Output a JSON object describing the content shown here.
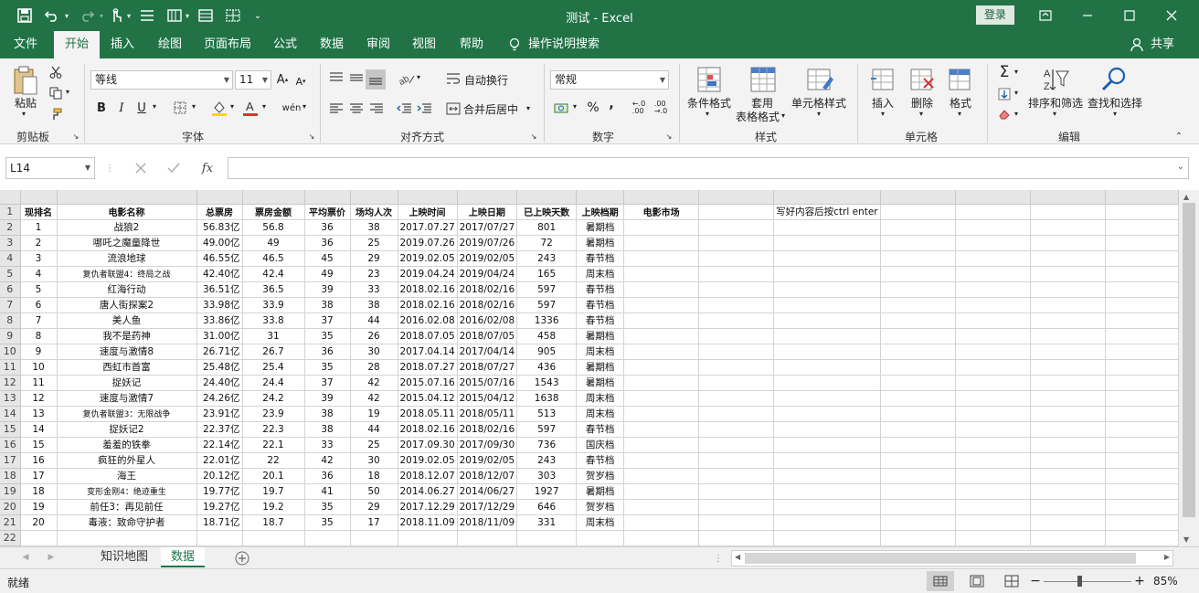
{
  "titlebar": {
    "doc_title": "测试  -  Excel",
    "login": "登录",
    "icons": [
      "save-icon",
      "undo-icon",
      "redo-icon",
      "touch-mode-icon",
      "list-icon",
      "form-icon",
      "borders-icon",
      "table-icon",
      "customize-qat-icon"
    ]
  },
  "tabs": [
    "文件",
    "开始",
    "插入",
    "绘图",
    "页面布局",
    "公式",
    "数据",
    "审阅",
    "视图",
    "帮助"
  ],
  "tell_me": "操作说明搜索",
  "share": "共享",
  "ribbon": {
    "clipboard": {
      "paste": "粘贴",
      "label": "剪贴板"
    },
    "font": {
      "name": "等线",
      "size": "11",
      "label": "字体",
      "bold": "B",
      "italic": "I",
      "underline": "U"
    },
    "alignment": {
      "wrap": "自动换行",
      "merge": "合并后居中",
      "label": "对齐方式"
    },
    "number": {
      "format": "常规",
      "percent": "%",
      "comma": ",",
      "label": "数字"
    },
    "styles": {
      "cond": "条件格式",
      "table1": "套用",
      "table2": "表格格式",
      "cell": "单元格样式",
      "label": "样式"
    },
    "cells": {
      "insert": "插入",
      "delete": "删除",
      "format": "格式",
      "label": "单元格"
    },
    "editing": {
      "sort": "排序和筛选",
      "find": "查找和选择",
      "label": "编辑"
    }
  },
  "formula_bar": {
    "name_box": "L14",
    "fx": "fx",
    "value": ""
  },
  "columns": [
    "A",
    "B",
    "C",
    "D",
    "E",
    "F",
    "G",
    "H",
    "I",
    "J",
    "K",
    "L",
    "M",
    "N",
    "O",
    "P",
    "Q"
  ],
  "headers": [
    "现排名",
    "电影名称",
    "总票房",
    "票房金额",
    "平均票价",
    "场均人次",
    "上映时间",
    "上映日期",
    "已上映天数",
    "上映档期",
    "电影市场",
    "",
    "写好内容后按ctrl enter",
    "",
    "",
    "",
    ""
  ],
  "rows": [
    [
      "1",
      "战狼2",
      "56.83亿",
      "56.8",
      "36",
      "38",
      "2017.07.27",
      "2017/07/27",
      "801",
      "暑期档"
    ],
    [
      "2",
      "哪吒之魔童降世",
      "49.00亿",
      "49",
      "36",
      "25",
      "2019.07.26",
      "2019/07/26",
      "72",
      "暑期档"
    ],
    [
      "3",
      "流浪地球",
      "46.55亿",
      "46.5",
      "45",
      "29",
      "2019.02.05",
      "2019/02/05",
      "243",
      "春节档"
    ],
    [
      "4",
      "复仇者联盟4：终局之战",
      "42.40亿",
      "42.4",
      "49",
      "23",
      "2019.04.24",
      "2019/04/24",
      "165",
      "周末档"
    ],
    [
      "5",
      "红海行动",
      "36.51亿",
      "36.5",
      "39",
      "33",
      "2018.02.16",
      "2018/02/16",
      "597",
      "春节档"
    ],
    [
      "6",
      "唐人街探案2",
      "33.98亿",
      "33.9",
      "38",
      "38",
      "2018.02.16",
      "2018/02/16",
      "597",
      "春节档"
    ],
    [
      "7",
      "美人鱼",
      "33.86亿",
      "33.8",
      "37",
      "44",
      "2016.02.08",
      "2016/02/08",
      "1336",
      "春节档"
    ],
    [
      "8",
      "我不是药神",
      "31.00亿",
      "31",
      "35",
      "26",
      "2018.07.05",
      "2018/07/05",
      "458",
      "暑期档"
    ],
    [
      "9",
      "速度与激情8",
      "26.71亿",
      "26.7",
      "36",
      "30",
      "2017.04.14",
      "2017/04/14",
      "905",
      "周末档"
    ],
    [
      "10",
      "西虹市首富",
      "25.48亿",
      "25.4",
      "35",
      "28",
      "2018.07.27",
      "2018/07/27",
      "436",
      "暑期档"
    ],
    [
      "11",
      "捉妖记",
      "24.40亿",
      "24.4",
      "37",
      "42",
      "2015.07.16",
      "2015/07/16",
      "1543",
      "暑期档"
    ],
    [
      "12",
      "速度与激情7",
      "24.26亿",
      "24.2",
      "39",
      "42",
      "2015.04.12",
      "2015/04/12",
      "1638",
      "周末档"
    ],
    [
      "13",
      "复仇者联盟3：无限战争",
      "23.91亿",
      "23.9",
      "38",
      "19",
      "2018.05.11",
      "2018/05/11",
      "513",
      "周末档"
    ],
    [
      "14",
      "捉妖记2",
      "22.37亿",
      "22.3",
      "38",
      "44",
      "2018.02.16",
      "2018/02/16",
      "597",
      "春节档"
    ],
    [
      "15",
      "羞羞的铁拳",
      "22.14亿",
      "22.1",
      "33",
      "25",
      "2017.09.30",
      "2017/09/30",
      "736",
      "国庆档"
    ],
    [
      "16",
      "疯狂的外星人",
      "22.01亿",
      "22",
      "42",
      "30",
      "2019.02.05",
      "2019/02/05",
      "243",
      "春节档"
    ],
    [
      "17",
      "海王",
      "20.12亿",
      "20.1",
      "36",
      "18",
      "2018.12.07",
      "2018/12/07",
      "303",
      "贺岁档"
    ],
    [
      "18",
      "变形金刚4：绝迹重生",
      "19.77亿",
      "19.7",
      "41",
      "50",
      "2014.06.27",
      "2014/06/27",
      "1927",
      "暑期档"
    ],
    [
      "19",
      "前任3：再见前任",
      "19.27亿",
      "19.2",
      "35",
      "29",
      "2017.12.29",
      "2017/12/29",
      "646",
      "贺岁档"
    ],
    [
      "20",
      "毒液：致命守护者",
      "18.71亿",
      "18.7",
      "35",
      "17",
      "2018.11.09",
      "2018/11/09",
      "331",
      "周末档"
    ]
  ],
  "sheets": [
    "知识地图",
    "数据"
  ],
  "status": {
    "ready": "就绪",
    "zoom": "85%",
    "zoom_level": 0.85
  }
}
